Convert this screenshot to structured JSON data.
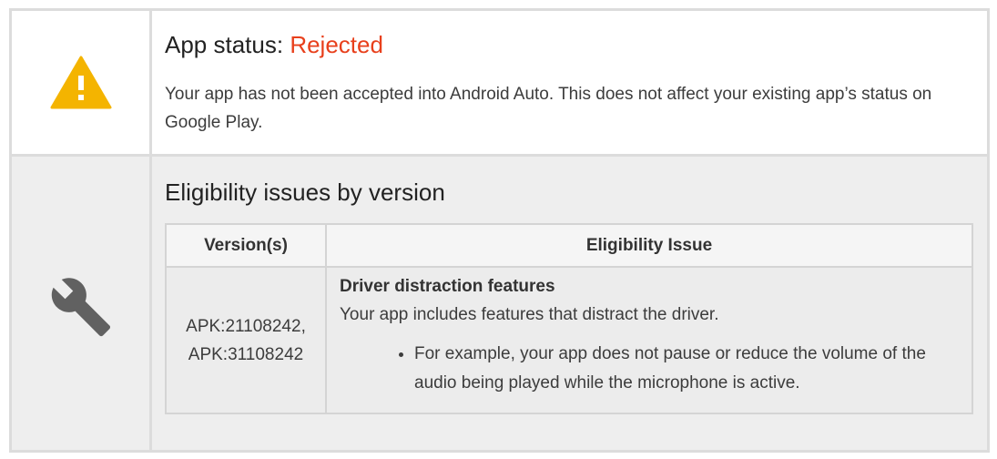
{
  "status": {
    "label": "App status: ",
    "value": "Rejected",
    "value_color": "#e8401c",
    "description": "Your app has not been accepted into Android Auto. This does not affect your existing app’s status on Google Play.",
    "icon": "warning-icon",
    "icon_color": "#f4b400"
  },
  "issues": {
    "title": "Eligibility issues by version",
    "icon": "wrench-icon",
    "table": {
      "headers": [
        "Version(s)",
        "Eligibility Issue"
      ],
      "rows": [
        {
          "versions": [
            "APK:21108242,",
            "APK:31108242"
          ],
          "issue_title": "Driver distraction features",
          "issue_description": "Your app includes features that distract the driver.",
          "examples": [
            "For example, your app does not pause or reduce the volume of the audio being played while the microphone is active."
          ]
        }
      ]
    }
  }
}
